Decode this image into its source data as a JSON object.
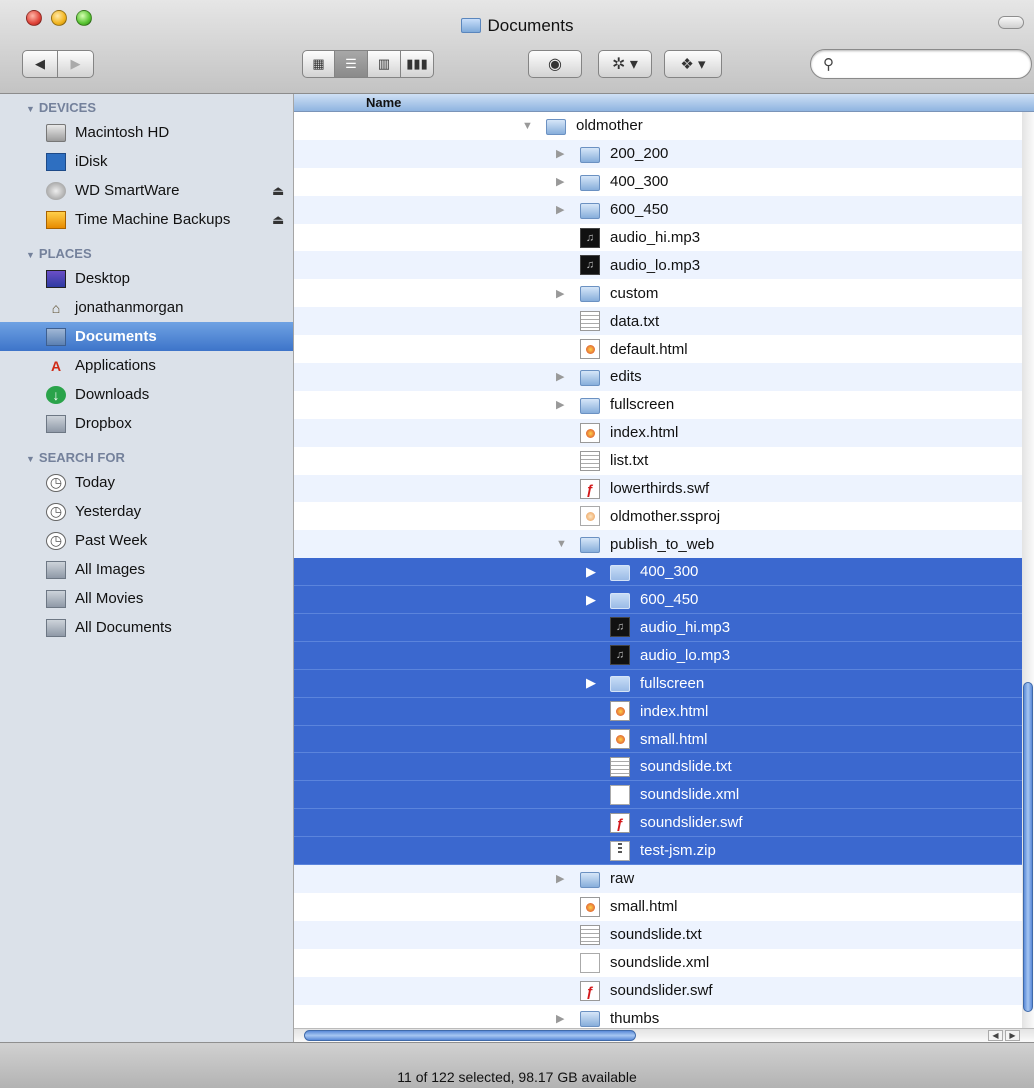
{
  "window": {
    "title": "Documents"
  },
  "toolbar": {
    "back_icon": "chevron-left",
    "forward_icon": "chevron-right",
    "view_modes": [
      "icon-view",
      "list-view",
      "column-view",
      "cover-flow-view"
    ],
    "active_view": "list-view",
    "quicklook_icon": "eye",
    "action_icon": "gear",
    "dropbox_icon": "dropbox",
    "search_placeholder": "",
    "search_value": ""
  },
  "sidebar": {
    "devices_label": "DEVICES",
    "devices": [
      {
        "label": "Macintosh HD",
        "icon": "hard-disk",
        "eject": false
      },
      {
        "label": "iDisk",
        "icon": "idisk",
        "eject": false
      },
      {
        "label": "WD SmartWare",
        "icon": "external-disk",
        "eject": true
      },
      {
        "label": "Time Machine Backups",
        "icon": "time-machine-disk",
        "eject": true
      }
    ],
    "places_label": "PLACES",
    "places": [
      {
        "label": "Desktop",
        "icon": "desktop",
        "selected": false
      },
      {
        "label": "jonathanmorgan",
        "icon": "home",
        "selected": false
      },
      {
        "label": "Documents",
        "icon": "documents-folder",
        "selected": true
      },
      {
        "label": "Applications",
        "icon": "applications",
        "selected": false
      },
      {
        "label": "Downloads",
        "icon": "downloads",
        "selected": false
      },
      {
        "label": "Dropbox",
        "icon": "folder",
        "selected": false
      }
    ],
    "search_label": "SEARCH FOR",
    "searches": [
      {
        "label": "Today",
        "icon": "clock"
      },
      {
        "label": "Yesterday",
        "icon": "clock"
      },
      {
        "label": "Past Week",
        "icon": "clock"
      },
      {
        "label": "All Images",
        "icon": "smart-folder"
      },
      {
        "label": "All Movies",
        "icon": "smart-folder"
      },
      {
        "label": "All Documents",
        "icon": "smart-folder"
      }
    ]
  },
  "list": {
    "column_name": "Name",
    "rows": [
      {
        "name": "oldmother",
        "type": "folder",
        "level": 0,
        "disclosure": "open",
        "selected": false
      },
      {
        "name": "200_200",
        "type": "folder",
        "level": 1,
        "disclosure": "closed",
        "selected": false
      },
      {
        "name": "400_300",
        "type": "folder",
        "level": 1,
        "disclosure": "closed",
        "selected": false
      },
      {
        "name": "600_450",
        "type": "folder",
        "level": 1,
        "disclosure": "closed",
        "selected": false
      },
      {
        "name": "audio_hi.mp3",
        "type": "mp3",
        "level": 1,
        "disclosure": "none",
        "selected": false
      },
      {
        "name": "audio_lo.mp3",
        "type": "mp3",
        "level": 1,
        "disclosure": "none",
        "selected": false
      },
      {
        "name": "custom",
        "type": "folder",
        "level": 1,
        "disclosure": "closed",
        "selected": false
      },
      {
        "name": "data.txt",
        "type": "txt",
        "level": 1,
        "disclosure": "none",
        "selected": false
      },
      {
        "name": "default.html",
        "type": "html",
        "level": 1,
        "disclosure": "none",
        "selected": false
      },
      {
        "name": "edits",
        "type": "folder",
        "level": 1,
        "disclosure": "closed",
        "selected": false
      },
      {
        "name": "fullscreen",
        "type": "folder",
        "level": 1,
        "disclosure": "closed",
        "selected": false
      },
      {
        "name": "index.html",
        "type": "html",
        "level": 1,
        "disclosure": "none",
        "selected": false
      },
      {
        "name": "list.txt",
        "type": "txt",
        "level": 1,
        "disclosure": "none",
        "selected": false
      },
      {
        "name": "lowerthirds.swf",
        "type": "swf",
        "level": 1,
        "disclosure": "none",
        "selected": false
      },
      {
        "name": "oldmother.ssproj",
        "type": "ssproj",
        "level": 1,
        "disclosure": "none",
        "selected": false
      },
      {
        "name": "publish_to_web",
        "type": "folder",
        "level": 1,
        "disclosure": "open",
        "selected": false
      },
      {
        "name": "400_300",
        "type": "folder",
        "level": 2,
        "disclosure": "closed",
        "selected": true
      },
      {
        "name": "600_450",
        "type": "folder",
        "level": 2,
        "disclosure": "closed",
        "selected": true
      },
      {
        "name": "audio_hi.mp3",
        "type": "mp3",
        "level": 2,
        "disclosure": "none",
        "selected": true
      },
      {
        "name": "audio_lo.mp3",
        "type": "mp3",
        "level": 2,
        "disclosure": "none",
        "selected": true
      },
      {
        "name": "fullscreen",
        "type": "folder",
        "level": 2,
        "disclosure": "closed",
        "selected": true
      },
      {
        "name": "index.html",
        "type": "html",
        "level": 2,
        "disclosure": "none",
        "selected": true
      },
      {
        "name": "small.html",
        "type": "html",
        "level": 2,
        "disclosure": "none",
        "selected": true
      },
      {
        "name": "soundslide.txt",
        "type": "txt",
        "level": 2,
        "disclosure": "none",
        "selected": true
      },
      {
        "name": "soundslide.xml",
        "type": "xml",
        "level": 2,
        "disclosure": "none",
        "selected": true
      },
      {
        "name": "soundslider.swf",
        "type": "swf",
        "level": 2,
        "disclosure": "none",
        "selected": true
      },
      {
        "name": "test-jsm.zip",
        "type": "zip",
        "level": 2,
        "disclosure": "none",
        "selected": true
      },
      {
        "name": "raw",
        "type": "folder",
        "level": 1,
        "disclosure": "closed",
        "selected": false
      },
      {
        "name": "small.html",
        "type": "html",
        "level": 1,
        "disclosure": "none",
        "selected": false
      },
      {
        "name": "soundslide.txt",
        "type": "txt",
        "level": 1,
        "disclosure": "none",
        "selected": false
      },
      {
        "name": "soundslide.xml",
        "type": "xml",
        "level": 1,
        "disclosure": "none",
        "selected": false
      },
      {
        "name": "soundslider.swf",
        "type": "swf",
        "level": 1,
        "disclosure": "none",
        "selected": false
      },
      {
        "name": "thumbs",
        "type": "folder",
        "level": 1,
        "disclosure": "closed",
        "selected": false
      }
    ]
  },
  "status": {
    "text": "11 of 122 selected, 98.17 GB available"
  },
  "colors": {
    "selection": "#3b68cf",
    "sidebar_bg": "#dbe1e9",
    "alt_row": "#edf3fe"
  }
}
